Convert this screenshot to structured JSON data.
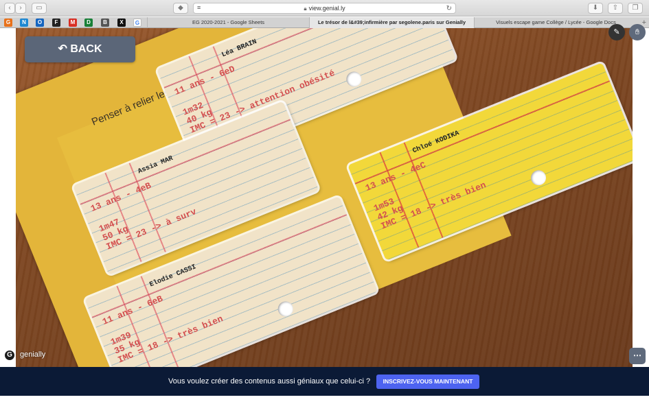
{
  "browser": {
    "url": "view.genial.ly",
    "bookmarks": [
      "G",
      "N",
      "O",
      "F",
      "M",
      "D",
      "B",
      "X",
      "G"
    ],
    "tabs": [
      {
        "label": "EG 2020-2021 - Google Sheets",
        "active": false
      },
      {
        "label": "Le trésor de l&#39;infirmière par segolene.paris sur Genially",
        "active": true
      },
      {
        "label": "Visuels escape game Collège / Lycée - Google Docs",
        "active": false
      }
    ]
  },
  "scene": {
    "back_label": "BACK",
    "folder_text": "Penser à relier les points...",
    "cards": [
      {
        "name": "Léa BRAIN",
        "age": "11 ans - 6eD",
        "height": "1m32",
        "weight": "40 kg",
        "imc": "IMC = 23 -> attention obésité"
      },
      {
        "name": "Assia MAR",
        "age": "13 ans - 4eB",
        "height": "1m47",
        "weight": "50 kg",
        "imc": "IMC = 23 -> à surv"
      },
      {
        "name": "Chloé KODIKA",
        "age": "13 ans - 4eC",
        "height": "1m53",
        "weight": "42 kg",
        "imc": "IMC = 18 -> très bien"
      },
      {
        "name": "Elodie CASSI",
        "age": "11 ans - 6eB",
        "height": "1m39",
        "weight": "35 kg",
        "imc": "IMC = 18 -> très bien"
      }
    ],
    "logo_text": "genially",
    "edit_icon": "pencil-icon",
    "hand_icon": "hand-icon",
    "more_icon": "more-icon"
  },
  "banner": {
    "message": "Vous voulez créer des contenus aussi géniaux que celui-ci ?",
    "cta": "INSCRIVEZ-VOUS MAINTENANT"
  }
}
